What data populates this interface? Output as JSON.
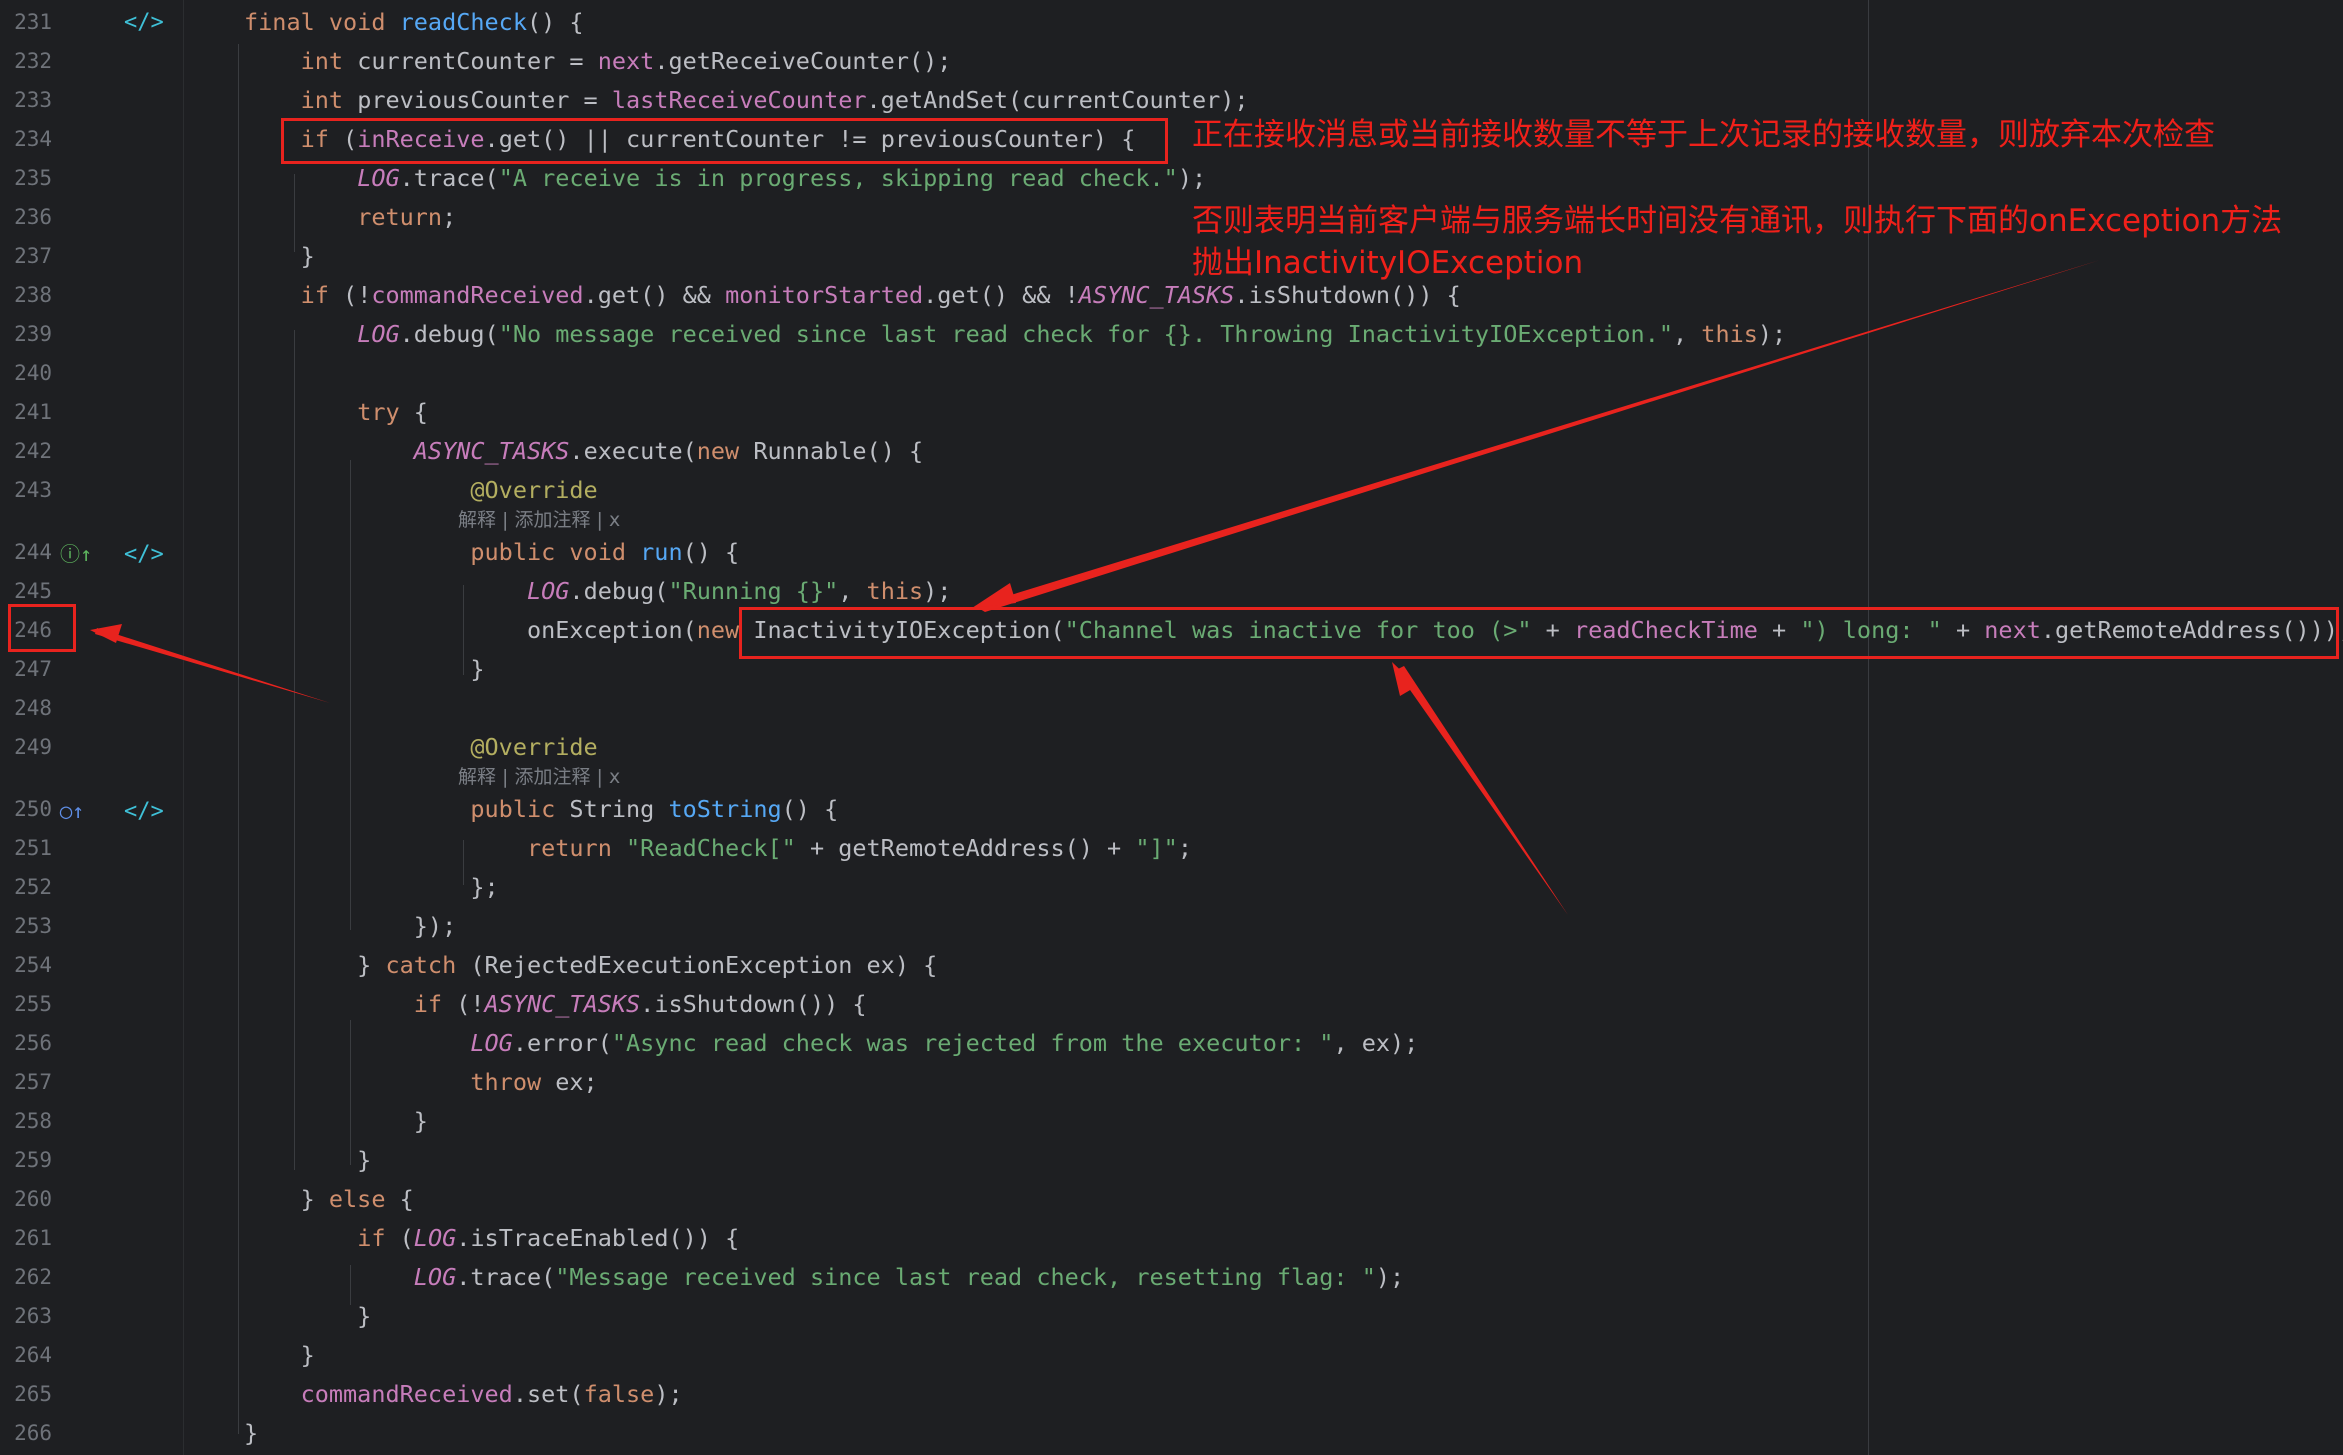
{
  "colors": {
    "background": "#1e1f22",
    "line_number": "#6f737a",
    "keyword": "#cf8e6d",
    "field": "#c77dbb",
    "method_decl": "#56a8f5",
    "string": "#6aab73",
    "annotation": "#b3ae60",
    "plain": "#bcbec4",
    "markup_red": "#e8231e"
  },
  "gutter_icons": {
    "line_231": "code-vision-icon",
    "line_244": "implements-method-icon",
    "line_250": "overrides-method-icon"
  },
  "lines": [
    {
      "num": "231",
      "tokens": [
        {
          "t": "final void ",
          "c": "kw"
        },
        {
          "t": "readCheck",
          "c": "fn"
        },
        {
          "t": "() {",
          "c": ""
        }
      ]
    },
    {
      "num": "232",
      "tokens": [
        {
          "t": "    "
        },
        {
          "t": "int ",
          "c": "kw"
        },
        {
          "t": "currentCounter = "
        },
        {
          "t": "next",
          "c": "fld"
        },
        {
          "t": ".getReceiveCounter();"
        }
      ]
    },
    {
      "num": "233",
      "tokens": [
        {
          "t": "    "
        },
        {
          "t": "int ",
          "c": "kw"
        },
        {
          "t": "previousCounter = "
        },
        {
          "t": "lastReceiveCounter",
          "c": "fld"
        },
        {
          "t": ".getAndSet(currentCounter);"
        }
      ]
    },
    {
      "num": "234",
      "tokens": [
        {
          "t": "    "
        },
        {
          "t": "if ",
          "c": "kw"
        },
        {
          "t": "("
        },
        {
          "t": "inReceive",
          "c": "fld"
        },
        {
          "t": ".get() || currentCounter != previousCounter) {"
        }
      ]
    },
    {
      "num": "235",
      "tokens": [
        {
          "t": "        "
        },
        {
          "t": "LOG",
          "c": "stat"
        },
        {
          "t": ".trace("
        },
        {
          "t": "\"A receive is in progress, skipping read check.\"",
          "c": "str"
        },
        {
          "t": ");"
        }
      ]
    },
    {
      "num": "236",
      "tokens": [
        {
          "t": "        "
        },
        {
          "t": "return",
          "c": "kw"
        },
        {
          "t": ";"
        }
      ]
    },
    {
      "num": "237",
      "tokens": [
        {
          "t": "    }"
        }
      ]
    },
    {
      "num": "238",
      "tokens": [
        {
          "t": "    "
        },
        {
          "t": "if ",
          "c": "kw"
        },
        {
          "t": "(!"
        },
        {
          "t": "commandReceived",
          "c": "fld"
        },
        {
          "t": ".get() && "
        },
        {
          "t": "monitorStarted",
          "c": "fld"
        },
        {
          "t": ".get() && !"
        },
        {
          "t": "ASYNC_TASKS",
          "c": "stat"
        },
        {
          "t": ".isShutdown()) {"
        }
      ]
    },
    {
      "num": "239",
      "tokens": [
        {
          "t": "        "
        },
        {
          "t": "LOG",
          "c": "stat"
        },
        {
          "t": ".debug("
        },
        {
          "t": "\"No message received since last read check for {}. Throwing InactivityIOException.\"",
          "c": "str"
        },
        {
          "t": ", "
        },
        {
          "t": "this",
          "c": "kw"
        },
        {
          "t": ");"
        }
      ]
    },
    {
      "num": "240",
      "tokens": []
    },
    {
      "num": "241",
      "tokens": [
        {
          "t": "        "
        },
        {
          "t": "try ",
          "c": "kw"
        },
        {
          "t": "{"
        }
      ]
    },
    {
      "num": "242",
      "tokens": [
        {
          "t": "            "
        },
        {
          "t": "ASYNC_TASKS",
          "c": "stat"
        },
        {
          "t": ".execute("
        },
        {
          "t": "new ",
          "c": "kw"
        },
        {
          "t": "Runnable() {"
        }
      ]
    },
    {
      "num": "243",
      "tokens": [
        {
          "t": "                "
        },
        {
          "t": "@Override",
          "c": "ann"
        }
      ],
      "hint": "解释 | 添加注释 | x"
    },
    {
      "num": "244",
      "tokens": [
        {
          "t": "                "
        },
        {
          "t": "public void ",
          "c": "kw"
        },
        {
          "t": "run",
          "c": "fn"
        },
        {
          "t": "() {"
        }
      ]
    },
    {
      "num": "245",
      "tokens": [
        {
          "t": "                    "
        },
        {
          "t": "LOG",
          "c": "stat"
        },
        {
          "t": ".debug("
        },
        {
          "t": "\"Running {}\"",
          "c": "str"
        },
        {
          "t": ", "
        },
        {
          "t": "this",
          "c": "kw"
        },
        {
          "t": ");"
        }
      ]
    },
    {
      "num": "246",
      "tokens": [
        {
          "t": "                    onException("
        },
        {
          "t": "new ",
          "c": "kw"
        },
        {
          "t": "InactivityIOException("
        },
        {
          "t": "\"Channel was inactive for too (>\"",
          "c": "str"
        },
        {
          "t": " + "
        },
        {
          "t": "readCheckTime",
          "c": "fld"
        },
        {
          "t": " + "
        },
        {
          "t": "\") long: \"",
          "c": "str"
        },
        {
          "t": " + "
        },
        {
          "t": "next",
          "c": "fld"
        },
        {
          "t": ".getRemoteAddress()));"
        }
      ]
    },
    {
      "num": "247",
      "tokens": [
        {
          "t": "                }"
        }
      ]
    },
    {
      "num": "248",
      "tokens": []
    },
    {
      "num": "249",
      "tokens": [
        {
          "t": "                "
        },
        {
          "t": "@Override",
          "c": "ann"
        }
      ],
      "hint": "解释 | 添加注释 | x"
    },
    {
      "num": "250",
      "tokens": [
        {
          "t": "                "
        },
        {
          "t": "public ",
          "c": "kw"
        },
        {
          "t": "String "
        },
        {
          "t": "toString",
          "c": "fn"
        },
        {
          "t": "() {"
        }
      ]
    },
    {
      "num": "251",
      "tokens": [
        {
          "t": "                    "
        },
        {
          "t": "return ",
          "c": "kw"
        },
        {
          "t": "\"ReadCheck[\"",
          "c": "str"
        },
        {
          "t": " + getRemoteAddress() + "
        },
        {
          "t": "\"]\"",
          "c": "str"
        },
        {
          "t": ";"
        }
      ]
    },
    {
      "num": "252",
      "tokens": [
        {
          "t": "                };"
        }
      ]
    },
    {
      "num": "253",
      "tokens": [
        {
          "t": "            });"
        }
      ]
    },
    {
      "num": "254",
      "tokens": [
        {
          "t": "        } "
        },
        {
          "t": "catch ",
          "c": "kw"
        },
        {
          "t": "(RejectedExecutionException ex) {"
        }
      ]
    },
    {
      "num": "255",
      "tokens": [
        {
          "t": "            "
        },
        {
          "t": "if ",
          "c": "kw"
        },
        {
          "t": "(!"
        },
        {
          "t": "ASYNC_TASKS",
          "c": "stat"
        },
        {
          "t": ".isShutdown()) {"
        }
      ]
    },
    {
      "num": "256",
      "tokens": [
        {
          "t": "                "
        },
        {
          "t": "LOG",
          "c": "stat"
        },
        {
          "t": ".error("
        },
        {
          "t": "\"Async read check was rejected from the executor: \"",
          "c": "str"
        },
        {
          "t": ", ex);"
        }
      ]
    },
    {
      "num": "257",
      "tokens": [
        {
          "t": "                "
        },
        {
          "t": "throw ",
          "c": "kw"
        },
        {
          "t": "ex;"
        }
      ]
    },
    {
      "num": "258",
      "tokens": [
        {
          "t": "            }"
        }
      ]
    },
    {
      "num": "259",
      "tokens": [
        {
          "t": "        }"
        }
      ]
    },
    {
      "num": "260",
      "tokens": [
        {
          "t": "    } "
        },
        {
          "t": "else ",
          "c": "kw"
        },
        {
          "t": "{"
        }
      ]
    },
    {
      "num": "261",
      "tokens": [
        {
          "t": "        "
        },
        {
          "t": "if ",
          "c": "kw"
        },
        {
          "t": "("
        },
        {
          "t": "LOG",
          "c": "stat"
        },
        {
          "t": ".isTraceEnabled()) {"
        }
      ]
    },
    {
      "num": "262",
      "tokens": [
        {
          "t": "            "
        },
        {
          "t": "LOG",
          "c": "stat"
        },
        {
          "t": ".trace("
        },
        {
          "t": "\"Message received since last read check, resetting flag: \"",
          "c": "str"
        },
        {
          "t": ");"
        }
      ]
    },
    {
      "num": "263",
      "tokens": [
        {
          "t": "        }"
        }
      ]
    },
    {
      "num": "264",
      "tokens": [
        {
          "t": "    }"
        }
      ]
    },
    {
      "num": "265",
      "tokens": [
        {
          "t": "    "
        },
        {
          "t": "commandReceived",
          "c": "fld"
        },
        {
          "t": ".set("
        },
        {
          "t": "false",
          "c": "kw"
        },
        {
          "t": ");"
        }
      ]
    },
    {
      "num": "266",
      "tokens": [
        {
          "t": "}"
        }
      ]
    }
  ],
  "annotations": {
    "note1": "正在接收消息或当前接收数量不等于上次记录的接收数量，则放弃本次检查",
    "note2_line1": "否则表明当前客户端与服务端长时间没有通讯，则执行下面的onException方法",
    "note2_line2": "抛出InactivityIOException"
  }
}
